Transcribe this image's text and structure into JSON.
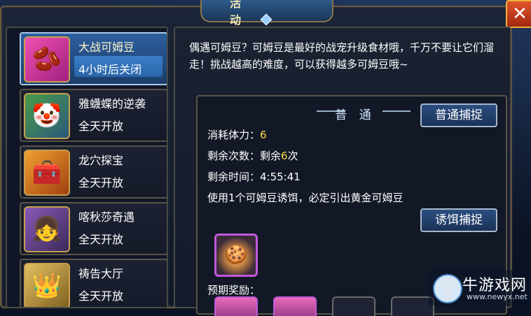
{
  "window": {
    "title": "活 动",
    "close_label": "✕"
  },
  "sidebar": {
    "items": [
      {
        "name": "大战可姆豆",
        "status": "4小时后关闭",
        "icon": "smiling-bean-icon",
        "glyph": "🫘",
        "thumb_color": "#d0349a",
        "active": true
      },
      {
        "name": "雅蠛蝶的逆袭",
        "status": "全天开放",
        "icon": "clown-character-icon",
        "glyph": "🤡",
        "thumb_color": "#3a7a3a",
        "active": false
      },
      {
        "name": "龙穴探宝",
        "status": "全天开放",
        "icon": "treasure-chest-icon",
        "glyph": "🧰",
        "thumb_color": "#d07020",
        "active": false
      },
      {
        "name": "喀秋莎奇遇",
        "status": "全天开放",
        "icon": "maid-girl-icon",
        "glyph": "👧",
        "thumb_color": "#6a3a8a",
        "active": false
      },
      {
        "name": "祷告大厅",
        "status": "全天开放",
        "icon": "goddess-icon",
        "glyph": "👑",
        "thumb_color": "#b8902a",
        "active": false
      }
    ]
  },
  "content": {
    "description": "偶遇可姆豆？可姆豆是最好的战宠升级食材哦，千万不要让它们溜走！挑战越高的难度，可以获得越多可姆豆哦~",
    "mode_title": "普 通",
    "normal_capture_label": "普通捕捉",
    "stamina_label": "消耗体力：",
    "stamina_value": "6",
    "remaining_label": "剩余次数：",
    "remaining_prefix": "剩余",
    "remaining_count": "6",
    "remaining_suffix": "次",
    "time_label": "剩余时间：",
    "time_value": "4:55:41",
    "bait_hint": "使用1个可姆豆诱饵，必定引出黄金可姆豆",
    "bait_capture_label": "诱饵捕捉",
    "bait_icon": "cookie-plate-icon",
    "rewards_label": "预期奖励：",
    "reward_slots": [
      {
        "filled": true,
        "icon": "reward-item-icon"
      },
      {
        "filled": true,
        "icon": "reward-item-icon"
      },
      {
        "filled": false,
        "icon": ""
      },
      {
        "filled": false,
        "icon": ""
      }
    ]
  },
  "watermark": {
    "name": "牛游戏网",
    "url": "www.newyx.net",
    "logo_icon": "cow-logo-icon"
  }
}
